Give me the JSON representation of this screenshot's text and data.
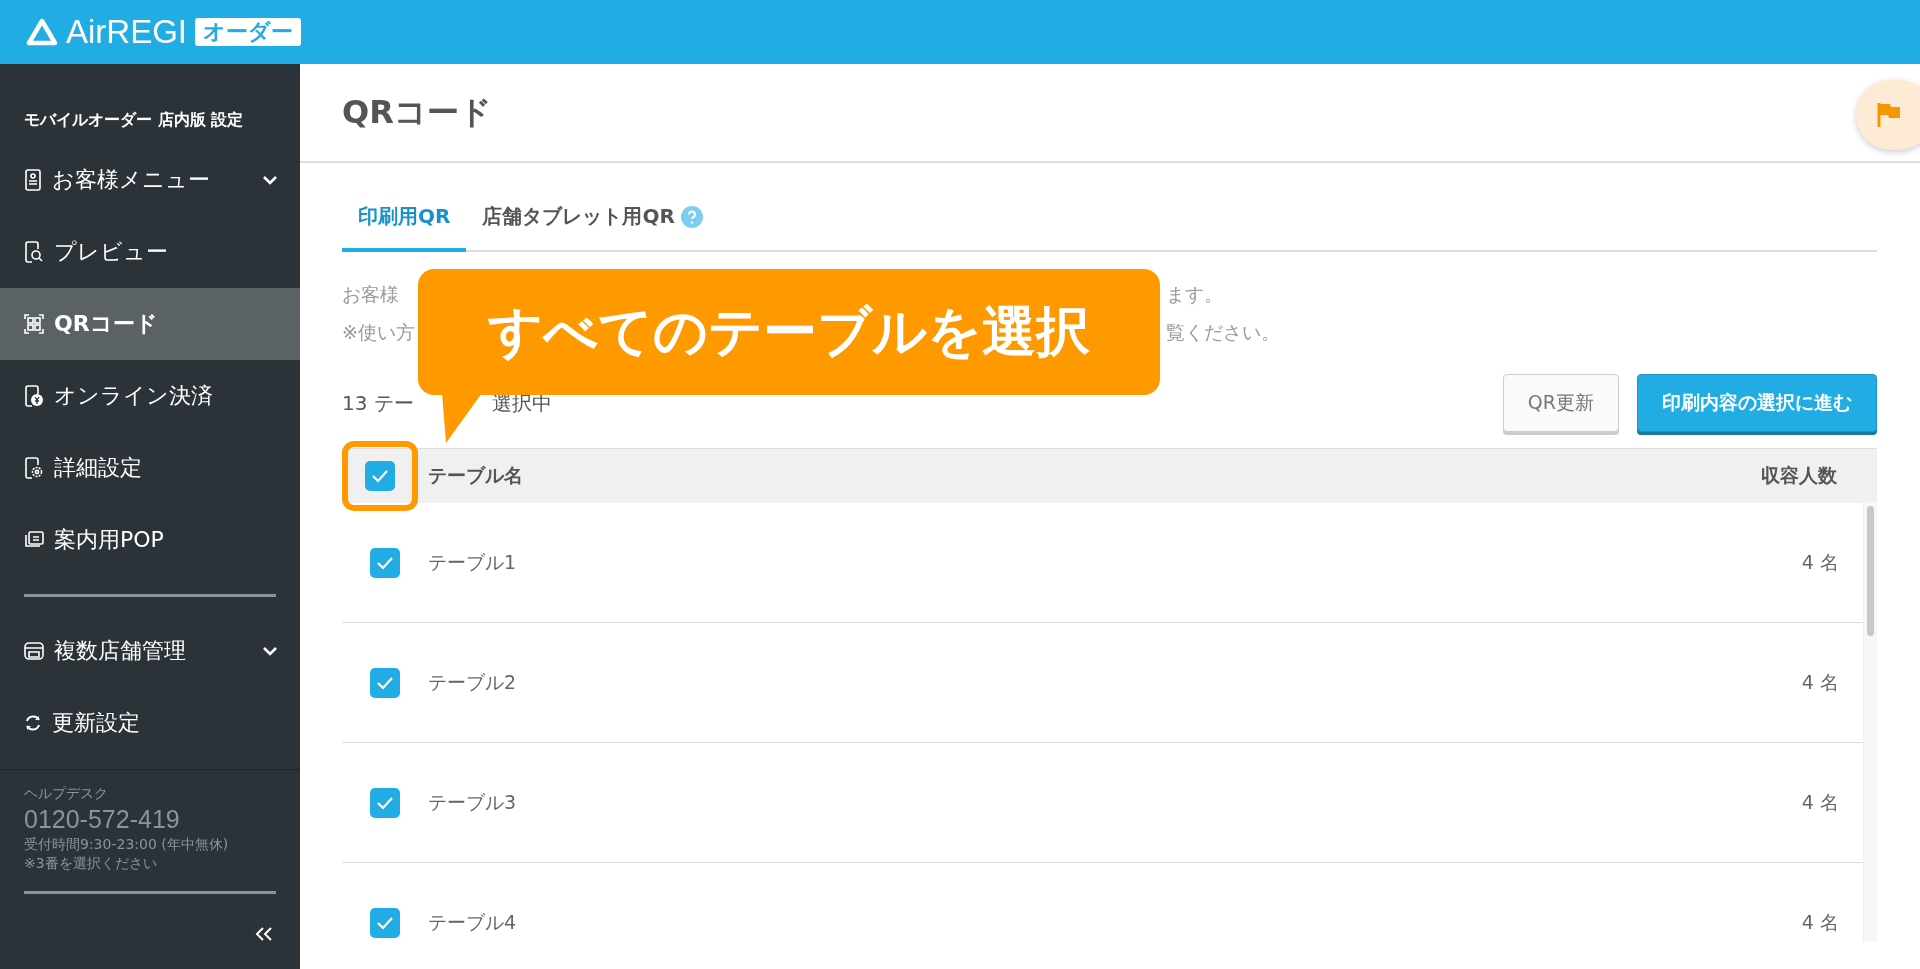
{
  "header": {
    "logo": "AirREGI",
    "badge": "オーダー"
  },
  "sidebar": {
    "title": "モバイルオーダー 店内版 設定",
    "groups": [
      {
        "items": [
          {
            "label": "お客様メニュー",
            "selected": false,
            "expandable": true
          },
          {
            "label": "プレビュー",
            "selected": false,
            "expandable": false
          },
          {
            "label": "QRコード",
            "selected": true,
            "expandable": false
          },
          {
            "label": "オンライン決済",
            "selected": false,
            "expandable": false
          },
          {
            "label": "詳細設定",
            "selected": false,
            "expandable": false
          },
          {
            "label": "案内用POP",
            "selected": false,
            "expandable": false
          }
        ]
      },
      {
        "items": [
          {
            "label": "複数店舗管理",
            "selected": false,
            "expandable": true
          },
          {
            "label": "更新設定",
            "selected": false,
            "expandable": false
          }
        ]
      }
    ],
    "help": {
      "label": "ヘルプデスク",
      "phone": "0120-572-419",
      "hours": "受付時間9:30-23:00 (年中無休)",
      "note": "※3番を選択ください"
    }
  },
  "page": {
    "title": "QRコード",
    "tabs": [
      {
        "label": "印刷用QR",
        "selected": true,
        "help": false
      },
      {
        "label": "店舗タブレット用QR",
        "selected": false,
        "help": true
      }
    ],
    "description": [
      {
        "start": "お客様",
        "end": "ます。"
      },
      {
        "start": "※使い方",
        "end": "覧ください。"
      }
    ],
    "count": {
      "start": "13 テー",
      "end": "選択中"
    },
    "buttons": [
      {
        "label": "QR更新",
        "kind": "secondary"
      },
      {
        "label": "印刷内容の選択に進む",
        "kind": "primary"
      }
    ],
    "table": {
      "columns": [
        "テーブル名",
        "収容人数"
      ],
      "all_checked": true,
      "rows": [
        {
          "name": "テーブル1",
          "capacity": "4 名",
          "checked": true
        },
        {
          "name": "テーブル2",
          "capacity": "4 名",
          "checked": true
        },
        {
          "name": "テーブル3",
          "capacity": "4 名",
          "checked": true
        },
        {
          "name": "テーブル4",
          "capacity": "4 名",
          "checked": true
        }
      ]
    }
  },
  "callout": {
    "text": "すべてのテーブルを選択"
  }
}
